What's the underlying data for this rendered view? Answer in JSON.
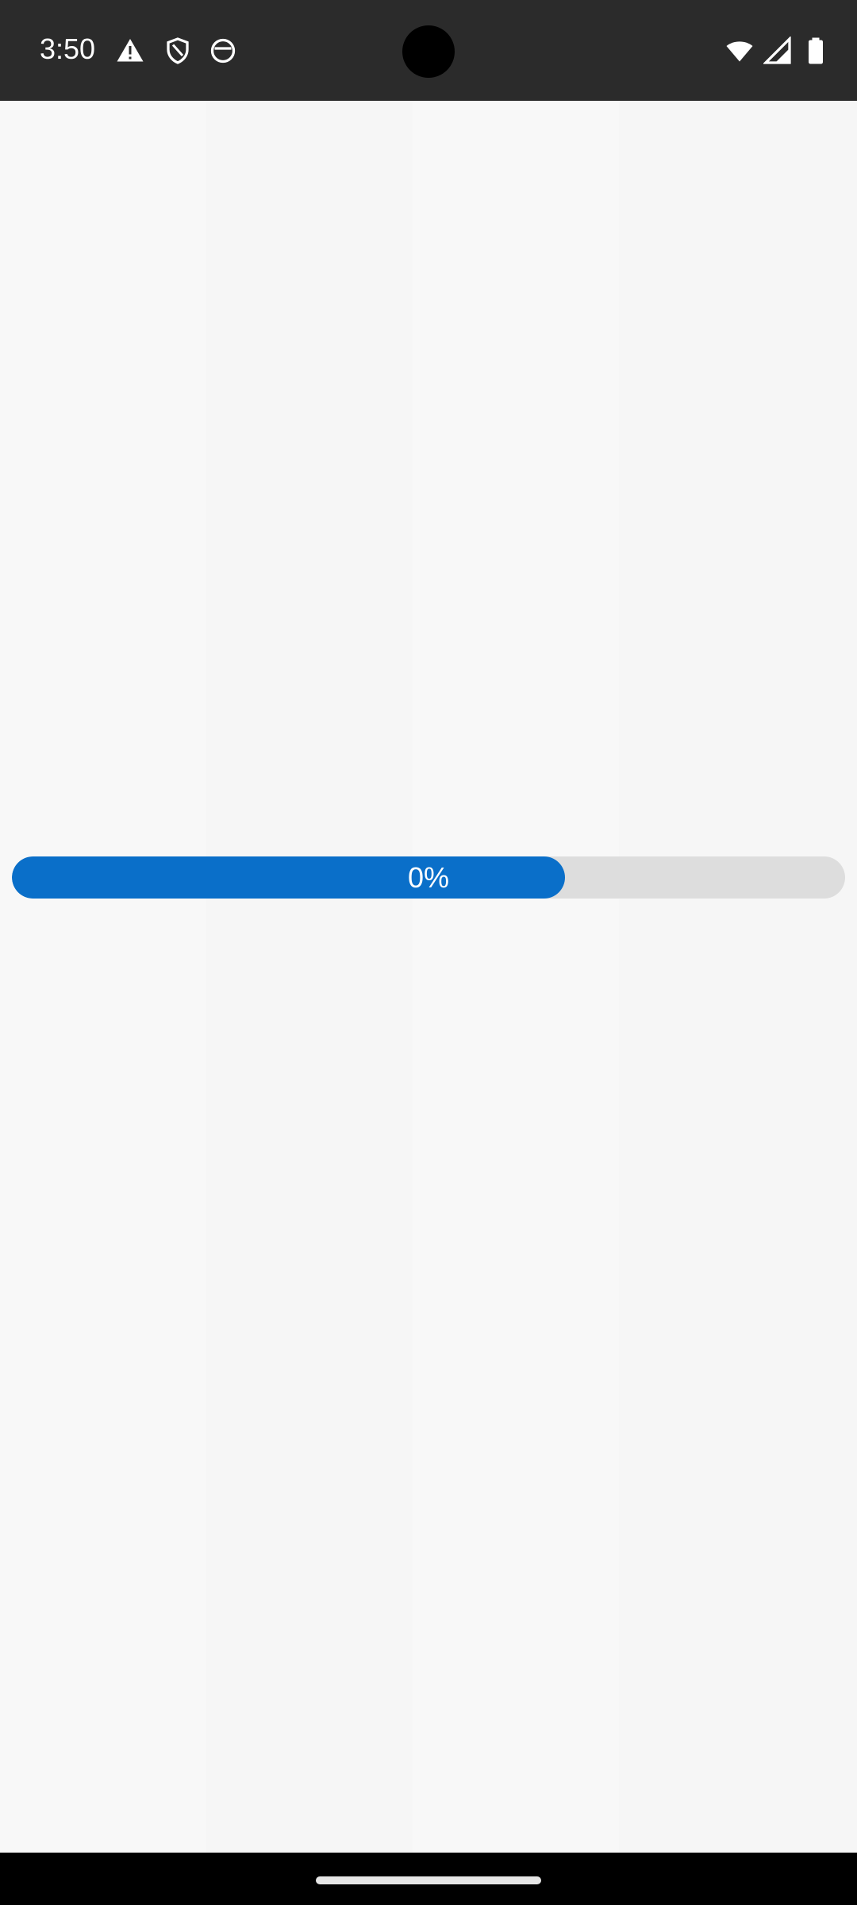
{
  "status_bar": {
    "time": "3:50",
    "left_icons": [
      "alert-triangle-icon",
      "shield-icon",
      "app-notification-icon"
    ],
    "right_icons": [
      "wifi-icon",
      "signal-icon",
      "battery-icon"
    ]
  },
  "progress": {
    "label": "0%",
    "fill_fraction": 0.664,
    "fill_color": "#0a6fc9",
    "track_color": "#dddddd"
  },
  "colors": {
    "background": "#f6f6f6",
    "status_bar": "#2b2b2b",
    "nav_bar": "#000000"
  }
}
